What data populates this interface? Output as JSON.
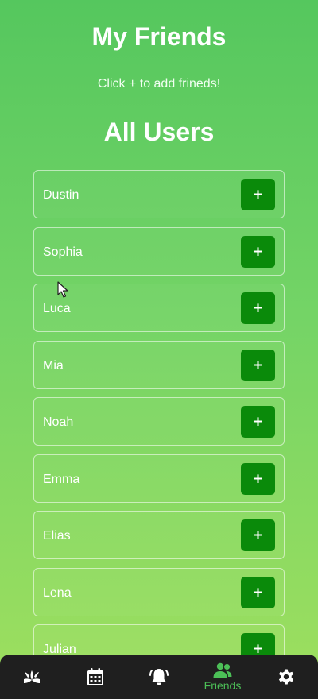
{
  "header": {
    "title": "My Friends",
    "hint": "Click + to add frineds!"
  },
  "users_section": {
    "title": "All Users",
    "add_label": "+",
    "users": [
      {
        "name": "Dustin"
      },
      {
        "name": "Sophia"
      },
      {
        "name": "Luca"
      },
      {
        "name": "Mia"
      },
      {
        "name": "Noah"
      },
      {
        "name": "Emma"
      },
      {
        "name": "Elias"
      },
      {
        "name": "Lena"
      },
      {
        "name": "Julian"
      }
    ]
  },
  "nav": {
    "items": [
      {
        "icon": "grass-icon",
        "label": "",
        "active": false
      },
      {
        "icon": "calendar-icon",
        "label": "",
        "active": false
      },
      {
        "icon": "bell-ringing-icon",
        "label": "",
        "active": false
      },
      {
        "icon": "friends-icon",
        "label": "Friends",
        "active": true
      },
      {
        "icon": "gear-icon",
        "label": "",
        "active": false
      }
    ]
  },
  "colors": {
    "accent": "#0a8a0a",
    "active_nav": "#4cbf57",
    "nav_bg": "#1f1f1f"
  }
}
